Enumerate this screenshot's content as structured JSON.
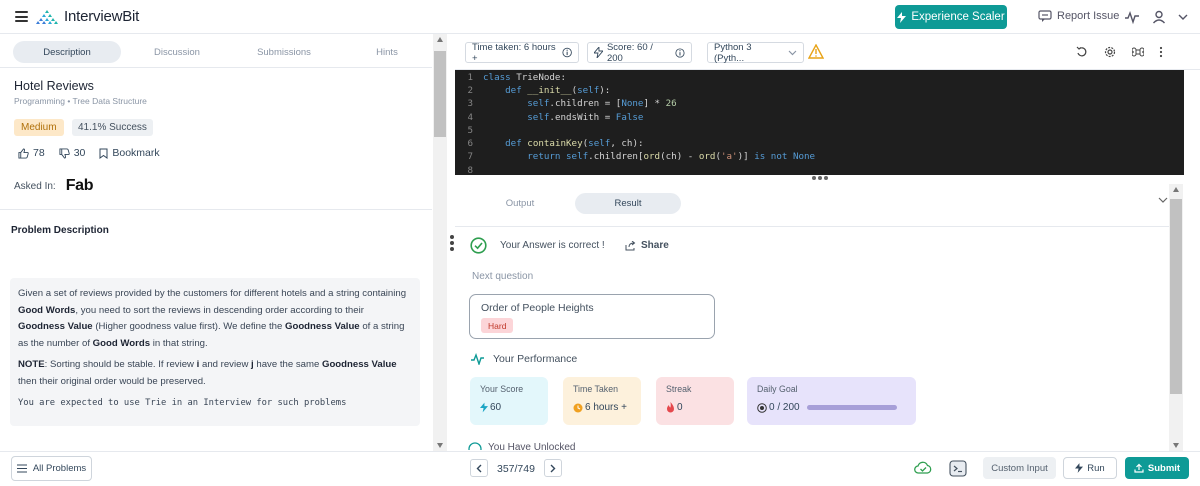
{
  "header": {
    "brand": "InterviewBit",
    "experience_button": "Experience Scaler",
    "report_issue": "Report Issue"
  },
  "left_tabs": [
    "Description",
    "Discussion",
    "Submissions",
    "Hints"
  ],
  "problem": {
    "title": "Hotel Reviews",
    "breadcrumb": "Programming • Tree Data Structure",
    "difficulty": "Medium",
    "success_rate": "41.1% Success",
    "likes": "78",
    "dislikes": "30",
    "bookmark_label": "Bookmark",
    "asked_in_label": "Asked In:",
    "asked_in_company": "Fab",
    "description_heading": "Problem Description",
    "description_note": "You are expected to use Trie in an Interview for such problems"
  },
  "toolbar": {
    "time_taken": "Time taken: 6 hours +",
    "score": "Score:  60  /  200",
    "language": "Python 3 (Pyth..."
  },
  "code_lines": [
    {
      "n": "1",
      "text": "class TrieNode:"
    },
    {
      "n": "2",
      "text": "    def __init__(self):"
    },
    {
      "n": "3",
      "text": "        self.children = [None] * 26"
    },
    {
      "n": "4",
      "text": "        self.endsWith = False"
    },
    {
      "n": "5",
      "text": ""
    },
    {
      "n": "6",
      "text": "    def containKey(self, ch):"
    },
    {
      "n": "7",
      "text": "        return self.children[ord(ch) - ord('a')] is not None"
    },
    {
      "n": "8",
      "text": ""
    }
  ],
  "result_tabs": [
    "Output",
    "Result"
  ],
  "result": {
    "status": "Your Answer is correct !",
    "share": "Share",
    "next_question_label": "Next question",
    "next_question_title": "Order of People Heights",
    "next_question_difficulty": "Hard",
    "performance_label": "Your Performance",
    "stats": {
      "score_label": "Your Score",
      "score_value": "60",
      "time_label": "Time Taken",
      "time_value": "6 hours +",
      "streak_label": "Streak",
      "streak_value": "0",
      "goal_label": "Daily Goal",
      "goal_value": "0 / 200",
      "goal_progress": 0
    },
    "unlocked_label": "You Have Unlocked"
  },
  "bottom": {
    "all_problems": "All Problems",
    "pagination": "357/749",
    "custom_input": "Custom Input",
    "run": "Run",
    "submit": "Submit"
  },
  "colors": {
    "brand_teal": "#0e9a96",
    "editor_bg": "#1e1e1e",
    "score_card": "#e3f7fb",
    "time_card": "#fdf1dc",
    "streak_card": "#fbe1e3",
    "goal_card": "#e7e3fb"
  }
}
